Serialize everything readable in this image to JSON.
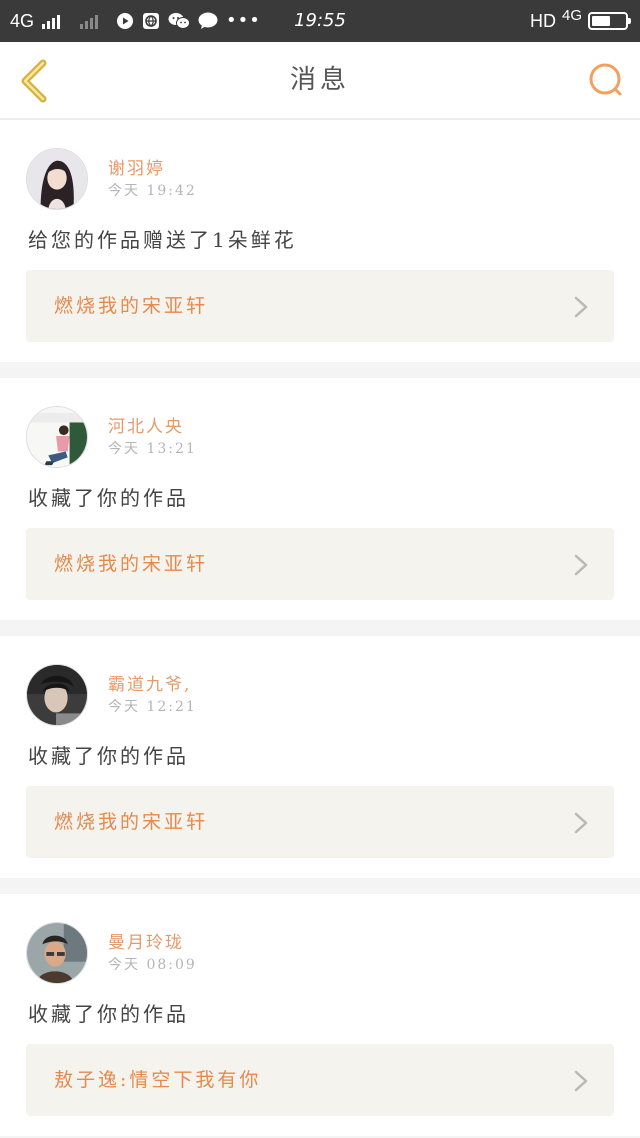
{
  "status_bar": {
    "network_label": "4G",
    "time": "19:55",
    "hd_label": "HD",
    "right_network": "4G",
    "battery_level": 0.55,
    "icons": [
      "signal-icon",
      "signal-dim-icon",
      "media-icon",
      "browser-icon",
      "wechat-icon",
      "chat-icon",
      "more-dots-icon",
      "battery-icon"
    ]
  },
  "header": {
    "title": "消息",
    "back_icon": "chevron-left-icon",
    "search_icon": "search-icon"
  },
  "colors": {
    "accent": "#e59a6a",
    "back_accent": "#d6b240",
    "search_accent": "#f2a060"
  },
  "messages": [
    {
      "name": "谢羽婷",
      "time": "今天 19:42",
      "text": "给您的作品赠送了1朵鲜花",
      "work": "燃烧我的宋亚轩"
    },
    {
      "name": "河北人央",
      "time": "今天 13:21",
      "text": "收藏了你的作品",
      "work": "燃烧我的宋亚轩"
    },
    {
      "name": "霸道九爷,",
      "time": "今天 12:21",
      "text": "收藏了你的作品",
      "work": "燃烧我的宋亚轩"
    },
    {
      "name": "曼月玲珑",
      "time": "今天 08:09",
      "text": "收藏了你的作品",
      "work": "敖子逸:情空下我有你"
    }
  ]
}
